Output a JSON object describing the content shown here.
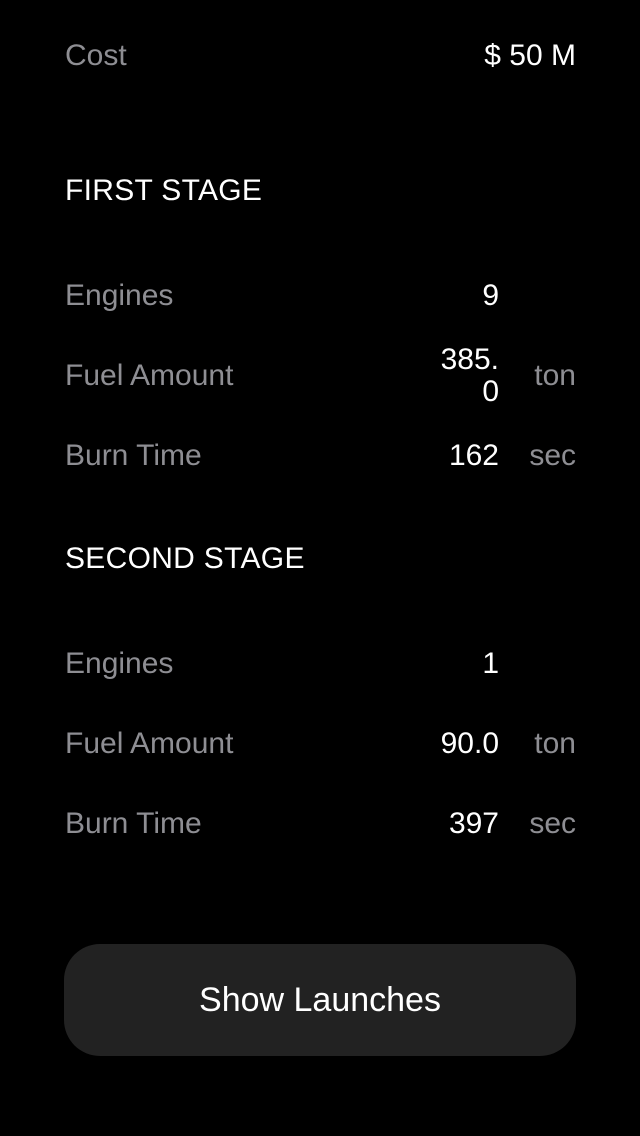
{
  "cost": {
    "label": "Cost",
    "value": "$ 50 M"
  },
  "first_stage": {
    "title": "FIRST STAGE",
    "engines": {
      "label": "Engines",
      "value": "9"
    },
    "fuel_amount": {
      "label": "Fuel Amount",
      "value": "385.0",
      "unit": "ton"
    },
    "burn_time": {
      "label": "Burn Time",
      "value": "162",
      "unit": "sec"
    }
  },
  "second_stage": {
    "title": "SECOND STAGE",
    "engines": {
      "label": "Engines",
      "value": "1"
    },
    "fuel_amount": {
      "label": "Fuel Amount",
      "value": "90.0",
      "unit": "ton"
    },
    "burn_time": {
      "label": "Burn Time",
      "value": "397",
      "unit": "sec"
    }
  },
  "actions": {
    "show_launches_label": "Show Launches"
  },
  "colors": {
    "background": "#000000",
    "label": "#8e8e93",
    "value": "#ffffff",
    "button": "#222222"
  }
}
